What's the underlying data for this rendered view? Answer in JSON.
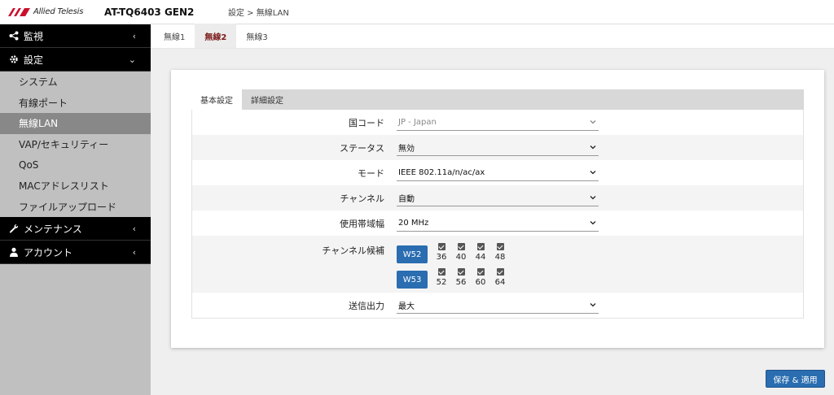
{
  "header": {
    "brand": "Allied Telesis",
    "model": "AT-TQ6403 GEN2",
    "breadcrumb": "設定 > 無線LAN"
  },
  "sidebar": {
    "sections": [
      {
        "label": "監視",
        "icon": "share-icon"
      },
      {
        "label": "設定",
        "icon": "gear-icon"
      },
      {
        "label": "メンテナンス",
        "icon": "wrench-icon"
      },
      {
        "label": "アカウント",
        "icon": "user-icon"
      }
    ],
    "settings_items": [
      {
        "label": "システム"
      },
      {
        "label": "有線ポート"
      },
      {
        "label": "無線LAN",
        "active": true
      },
      {
        "label": "VAP/セキュリティー"
      },
      {
        "label": "QoS"
      },
      {
        "label": "MACアドレスリスト"
      },
      {
        "label": "ファイルアップロード"
      }
    ]
  },
  "radio_tabs": [
    {
      "label": "無線1"
    },
    {
      "label": "無線2",
      "active": true
    },
    {
      "label": "無線3"
    }
  ],
  "sub_tabs": [
    {
      "label": "基本設定",
      "active": true
    },
    {
      "label": "詳細設定"
    }
  ],
  "form": {
    "country": {
      "label": "国コード",
      "value": "JP - Japan"
    },
    "status": {
      "label": "ステータス",
      "value": "無効"
    },
    "mode": {
      "label": "モード",
      "value": "IEEE 802.11a/n/ac/ax"
    },
    "channel": {
      "label": "チャンネル",
      "value": "自動"
    },
    "bandwidth": {
      "label": "使用帯域幅",
      "value": "20 MHz"
    },
    "channel_candidates": {
      "label": "チャンネル候補",
      "groups": [
        {
          "name": "W52",
          "channels": [
            "36",
            "40",
            "44",
            "48"
          ]
        },
        {
          "name": "W53",
          "channels": [
            "52",
            "56",
            "60",
            "64"
          ]
        }
      ]
    },
    "tx_power": {
      "label": "送信出力",
      "value": "最大"
    }
  },
  "actions": {
    "save_label": "保存 & 適用"
  },
  "colors": {
    "accent": "#2a6db0",
    "active_tab_text": "#7a1a1a",
    "sidebar_head": "#000000",
    "sidebar_bg": "#c0c0c0",
    "sidebar_active": "#888888"
  }
}
